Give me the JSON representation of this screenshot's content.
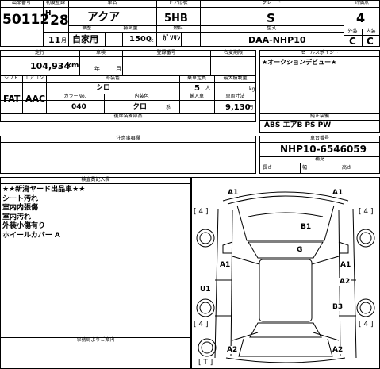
{
  "header": {
    "lot_label": "出品番号",
    "lot_no": "50112",
    "reg_label": "初度登録",
    "era": "H",
    "year": "28",
    "month": "11",
    "month_unit": "月",
    "name_label": "車名",
    "car_name": "アクア",
    "use_label": "車歴",
    "use": "自家用",
    "door_label": "ドア形状",
    "door": "5HB",
    "disp_label": "排気量",
    "disp": "1500",
    "disp_unit": "cc",
    "fuel_label": "燃料",
    "fuel": "ｶﾞｿﾘﾝ",
    "grade_label": "グレード",
    "grade": "S",
    "model_label": "型式",
    "model": "DAA-NHP10",
    "score_label": "評価点",
    "score": "4",
    "ext_label": "外装",
    "ext": "C",
    "int_label": "内装",
    "int": "C"
  },
  "spec": {
    "mileage_label": "走行",
    "mileage": "104,934",
    "mileage_unit": "km",
    "inspection_label": "車検",
    "insp_year_unit": "年",
    "insp_month_unit": "月",
    "plate_label": "登録番号",
    "reg_no_label": "名変期限",
    "shift_label": "シフト",
    "shift": "FAT",
    "ac_label": "エアコン",
    "ac": "AAC",
    "color_label": "外装色",
    "color": "シロ",
    "color_no_label": "カラーNo.",
    "color_no": "040",
    "interior_label": "内装色",
    "interior": "クロ",
    "seats_label": "乗車定員",
    "seats": "5",
    "seats_unit": "人",
    "capacity_label": "最大積載量",
    "capacity_unit": "kg",
    "import_label": "輸入車",
    "import_unit": "系",
    "length_label": "車両寸法",
    "length": "9,130",
    "length_unit": "円",
    "selling_label": "セールスポイント",
    "selling": "★オークションデビュー★",
    "option_label": "後席装備部品",
    "equip_label": "純正装備",
    "equip": "ABS エアB PS PW"
  },
  "notes": {
    "label": "注意事項欄"
  },
  "chassis": {
    "label": "車台番号",
    "value": "NHP10-6546059",
    "sub_label": "補充",
    "len_label": "長さ",
    "wid_label": "幅",
    "hei_label": "高さ"
  },
  "inspector": {
    "label": "検査員記入欄",
    "lines": [
      "★★新潟ヤード出品車★★",
      "シート汚れ",
      "室内内張傷",
      "室内汚れ",
      "外装小傷有り",
      "ホイールカバー A"
    ]
  },
  "office": {
    "label": "事務局よりご案内"
  },
  "diagram": {
    "marks": [
      "A1",
      "A1",
      "B1",
      "G",
      "A1",
      "A1",
      "U1",
      "A2",
      "B3",
      "A2",
      "A2"
    ],
    "brackets": [
      "[ 4 ]",
      "[ 4 ]",
      "[ 4 ]",
      "[ 4 ]",
      "[ T ]"
    ]
  }
}
